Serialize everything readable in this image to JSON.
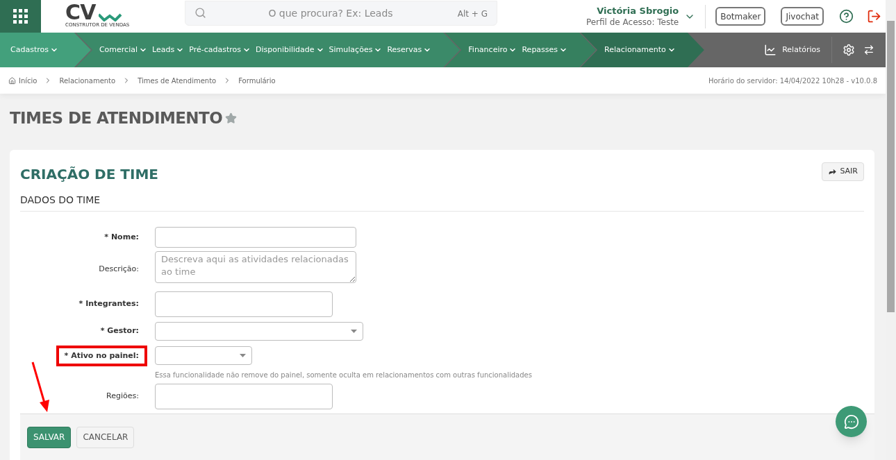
{
  "logo": {
    "mark": "CV",
    "tagline": "CONSTRUTOR DE VENDAS"
  },
  "search": {
    "placeholder": "O que procura? Ex: Leads",
    "shortcut": "Alt + G"
  },
  "user": {
    "name": "Victória Sbrogio",
    "profile": "Perfil de Acesso: Teste"
  },
  "header_buttons": [
    "Botmaker",
    "Jivochat"
  ],
  "nav": {
    "segments": [
      {
        "items": [
          "Cadastros"
        ]
      },
      {
        "items": [
          "Comercial",
          "Leads",
          "Pré-cadastros",
          "Disponibilidade",
          "Simulações",
          "Reservas"
        ]
      },
      {
        "items": [
          "Financeiro",
          "Repasses"
        ]
      },
      {
        "items": [
          "Relacionamento"
        ]
      }
    ],
    "reports": "Relatórios"
  },
  "breadcrumb": [
    "Início",
    "Relacionamento",
    "Times de Atendimento",
    "Formulário"
  ],
  "server_time": "Horário do servidor: 14/04/2022 10h28 - v10.0.8",
  "page_title": "TIMES DE ATENDIMENTO",
  "card": {
    "title": "CRIAÇÃO DE TIME",
    "exit_button": "SAIR",
    "section": "DADOS DO TIME"
  },
  "fields": [
    {
      "kind": "text",
      "label": "* Nome:",
      "required": true,
      "highlighted": false
    },
    {
      "kind": "textarea",
      "label": "Descrição:",
      "required": false,
      "highlighted": false,
      "placeholder": "Descreva aqui as atividades relacionadas ao time"
    },
    {
      "kind": "tags",
      "label": "* Integrantes:",
      "required": true,
      "highlighted": false
    },
    {
      "kind": "select",
      "label": "* Gestor:",
      "required": true,
      "highlighted": false
    },
    {
      "kind": "select-small",
      "label": "* Ativo no painel:",
      "required": true,
      "highlighted": true,
      "hint": "Essa funcionalidade não remove do painel, somente oculta em relacionamentos com outras funcionalidades"
    },
    {
      "kind": "tags",
      "label": "Regiões:",
      "required": false,
      "highlighted": false
    }
  ],
  "actions": [
    {
      "label": "SALVAR",
      "kind": "primary"
    },
    {
      "label": "CANCELAR",
      "kind": "secondary"
    }
  ]
}
